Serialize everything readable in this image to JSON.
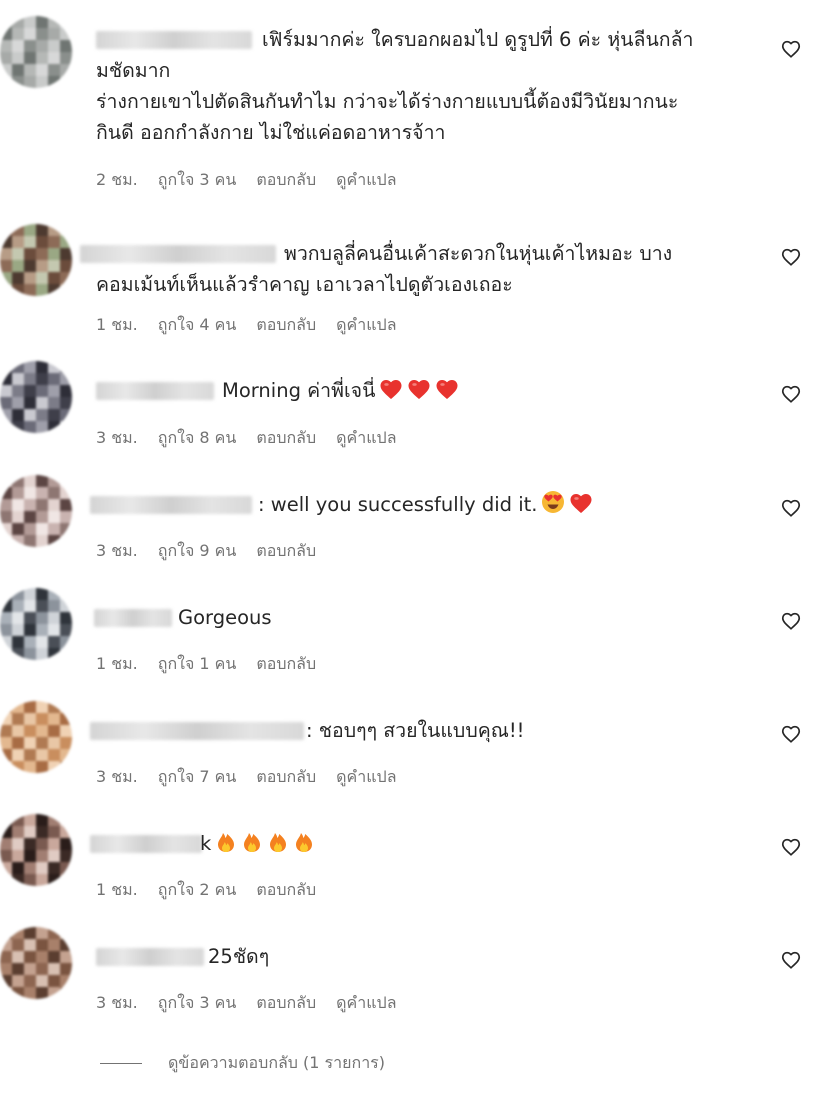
{
  "comments": [
    {
      "lines": [
        "เฟิร์มมากค่ะ ใครบอกผอมไป ดูรูปที่ 6 ค่ะ หุ่นลีนกล้า",
        "มชัดมาก",
        "ร่างกายเขาไปตัดสินกันทำไม กว่าจะได้ร่างกายแบบนี้ต้องมีวินัยมากนะ",
        "กินดี ออกกำลังกาย ไม่ใช่แค่อดอาหารจ้าา"
      ],
      "time": "2 ชม.",
      "likes": "ถูกใจ 3 คน",
      "reply": "ตอบกลับ",
      "translate": "ดูคำแปล",
      "avatar": [
        "#8a8f8c",
        "#a7aaa8",
        "#c9cbca",
        "#6f7572",
        "#b5b8b6",
        "#d7d8d8"
      ]
    },
    {
      "lines": [
        "พวกบลูลี่คนอื่นเค้าสะดวกในหุ่นเค้าไหมอะ บาง",
        "คอมเม้นท์เห็นแล้วรำคาญ เอาเวลาไปดูตัวเองเถอะ"
      ],
      "time": "1 ชม.",
      "likes": "ถูกใจ 4 คน",
      "reply": "ตอบกลับ",
      "translate": "ดูคำแปล",
      "avatar": [
        "#6b4c3c",
        "#8d6b57",
        "#9aa884",
        "#4d3a30",
        "#b79c86",
        "#c4c8b0"
      ]
    },
    {
      "lines": [
        "Morning ค่าพี่เจนี่"
      ],
      "emoji": [
        "heart",
        "heart",
        "heart"
      ],
      "time": "3 ชม.",
      "likes": "ถูกใจ 8 คน",
      "reply": "ตอบกลับ",
      "translate": "ดูคำแปล",
      "avatar": [
        "#3f3f4a",
        "#6b6b78",
        "#9f9faa",
        "#2e2e38",
        "#c9c9d0",
        "#7c7c88"
      ]
    },
    {
      "lines": [
        ": well you successfully did it."
      ],
      "emoji": [
        "heart-eyes",
        "heart"
      ],
      "time": "3 ชม.",
      "likes": "ถูกใจ 9 คน",
      "reply": "ตอบกลับ",
      "translate": "",
      "avatar": [
        "#c9b3b0",
        "#8e7672",
        "#e3d3d0",
        "#5c4543",
        "#b29a96",
        "#f0e6e4"
      ]
    },
    {
      "lines": [
        "Gorgeous"
      ],
      "time": "1 ชม.",
      "likes": "ถูกใจ 1 คน",
      "reply": "ตอบกลับ",
      "translate": "",
      "avatar": [
        "#4a4f57",
        "#8c939c",
        "#cfd3d8",
        "#2f343b",
        "#a9b0b8",
        "#e2e5e8"
      ]
    },
    {
      "lines": [
        ": ชอบๆๆ สวยในแบบคุณ!!"
      ],
      "time": "3 ชม.",
      "likes": "ถูกใจ 7 คน",
      "reply": "ตอบกลับ",
      "translate": "ดูคำแปล",
      "avatar": [
        "#c98e5e",
        "#e3b88f",
        "#a86c44",
        "#f0d2b4",
        "#b07a52",
        "#e9c7a6"
      ]
    },
    {
      "lines": [
        "k"
      ],
      "emoji": [
        "fire",
        "fire",
        "fire",
        "fire"
      ],
      "time": "1 ชม.",
      "likes": "ถูกใจ 2 คน",
      "reply": "ตอบกลับ",
      "translate": "",
      "avatar": [
        "#3b2a25",
        "#7a5a50",
        "#c9a89c",
        "#2a1d1a",
        "#a17e72",
        "#e0cbc3"
      ]
    },
    {
      "lines": [
        "25ชัดๆ"
      ],
      "time": "3 ชม.",
      "likes": "ถูกใจ 3 คน",
      "reply": "ตอบกลับ",
      "translate": "ดูคำแปล",
      "avatar": [
        "#7a5440",
        "#a8806a",
        "#5b3e30",
        "#c4a290",
        "#8d6550",
        "#d8c0b2"
      ]
    }
  ],
  "view_replies": "ดูข้อความตอบกลับ (1 รายการ)"
}
